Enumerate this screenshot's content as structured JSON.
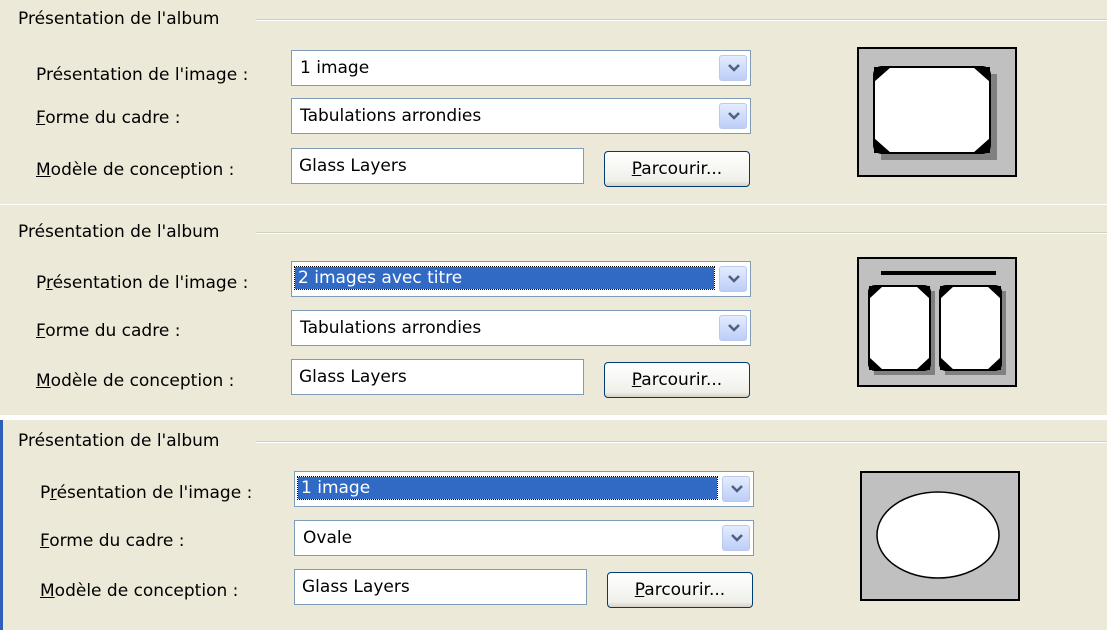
{
  "sections": [
    {
      "legend": "Présentation de l'album",
      "image_layout_label": "Présentation de l'image :",
      "image_layout_value": "1 image",
      "frame_shape_label": "Forme du cadre :",
      "frame_shape_value": "Tabulations arrondies",
      "theme_label": "Modèle de conception :",
      "theme_value": "Glass Layers",
      "browse_label": "Parcourir..."
    },
    {
      "legend": "Présentation de l'album",
      "image_layout_label": "Présentation de l'image :",
      "image_layout_value": "2 images avec titre",
      "frame_shape_label": "Forme du cadre :",
      "frame_shape_value": "Tabulations arrondies",
      "theme_label": "Modèle de conception :",
      "theme_value": "Glass Layers",
      "browse_label": "Parcourir..."
    },
    {
      "legend": "Présentation de l'album",
      "image_layout_label": "Présentation de l'image :",
      "image_layout_value": "1 image",
      "frame_shape_label": "Forme du cadre :",
      "frame_shape_value": "Ovale",
      "theme_label": "Modèle de conception :",
      "theme_value": "Glass Layers",
      "browse_label": "Parcourir..."
    }
  ],
  "colors": {
    "panel_background": "#ece9d8",
    "selection_highlight": "#316ac5",
    "field_border": "#7f9db9",
    "button_border": "#003c74"
  },
  "icons": [
    "chevron-down-icon"
  ]
}
